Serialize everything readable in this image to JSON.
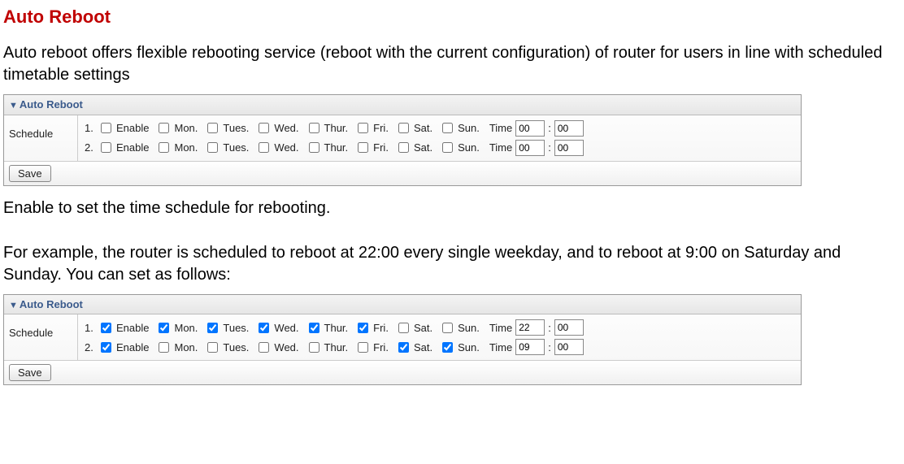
{
  "title": "Auto Reboot",
  "intro": "Auto reboot offers flexible rebooting service (reboot with the current configuration) of router for users in line with scheduled timetable settings",
  "panel_title": "Auto Reboot",
  "schedule_label": "Schedule",
  "save_label": "Save",
  "labels": {
    "enable": "Enable",
    "mon": "Mon.",
    "tue": "Tues.",
    "wed": "Wed.",
    "thu": "Thur.",
    "fri": "Fri.",
    "sat": "Sat.",
    "sun": "Sun.",
    "time": "Time"
  },
  "panel1": {
    "rows": [
      {
        "idx": "1.",
        "enable": false,
        "mon": false,
        "tue": false,
        "wed": false,
        "thu": false,
        "fri": false,
        "sat": false,
        "sun": false,
        "hh": "00",
        "mm": "00"
      },
      {
        "idx": "2.",
        "enable": false,
        "mon": false,
        "tue": false,
        "wed": false,
        "thu": false,
        "fri": false,
        "sat": false,
        "sun": false,
        "hh": "00",
        "mm": "00"
      }
    ]
  },
  "between1": "Enable to set the time schedule for rebooting.",
  "between2": "For example, the router is scheduled to reboot at 22:00 every single weekday, and to reboot at 9:00 on Saturday and Sunday. You can set as follows:",
  "panel2": {
    "rows": [
      {
        "idx": "1.",
        "enable": true,
        "mon": true,
        "tue": true,
        "wed": true,
        "thu": true,
        "fri": true,
        "sat": false,
        "sun": false,
        "hh": "22",
        "mm": "00"
      },
      {
        "idx": "2.",
        "enable": true,
        "mon": false,
        "tue": false,
        "wed": false,
        "thu": false,
        "fri": false,
        "sat": true,
        "sun": true,
        "hh": "09",
        "mm": "00"
      }
    ]
  }
}
